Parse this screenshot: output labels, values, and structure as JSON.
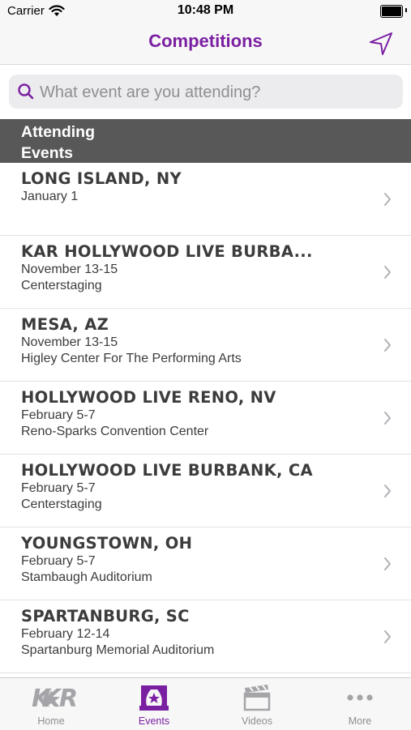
{
  "status_bar": {
    "carrier": "Carrier",
    "time": "10:48 PM"
  },
  "nav": {
    "title": "Competitions",
    "title_color": "#7b1fa2",
    "location_icon": "location-arrow-icon"
  },
  "search": {
    "placeholder": "What event are you attending?",
    "value": ""
  },
  "section": {
    "header": "Attending Events"
  },
  "events": [
    {
      "title": "LONG ISLAND, NY",
      "dates": "January 1",
      "venue": ""
    },
    {
      "title": "KAR HOLLYWOOD LIVE BURBA...",
      "dates": "November 13-15",
      "venue": "Centerstaging"
    },
    {
      "title": "MESA, AZ",
      "dates": "November 13-15",
      "venue": "Higley Center For The Performing Arts"
    },
    {
      "title": "HOLLYWOOD LIVE RENO, NV",
      "dates": "February 5-7",
      "venue": "Reno-Sparks Convention Center"
    },
    {
      "title": "HOLLYWOOD LIVE BURBANK, CA",
      "dates": "February 5-7",
      "venue": "Centerstaging"
    },
    {
      "title": "YOUNGSTOWN, OH",
      "dates": "February 5-7",
      "venue": "Stambaugh Auditorium"
    },
    {
      "title": "SPARTANBURG, SC",
      "dates": "February 12-14",
      "venue": "Spartanburg Memorial Auditorium"
    }
  ],
  "tab_bar": {
    "active_color": "#7b1fa2",
    "inactive_color": "#8e8e93",
    "tabs": [
      {
        "label": "Home",
        "icon": "kar-logo-icon",
        "active": false
      },
      {
        "label": "Events",
        "icon": "stage-icon",
        "active": true
      },
      {
        "label": "Videos",
        "icon": "clapperboard-icon",
        "active": false
      },
      {
        "label": "More",
        "icon": "more-dots-icon",
        "active": false
      }
    ]
  }
}
